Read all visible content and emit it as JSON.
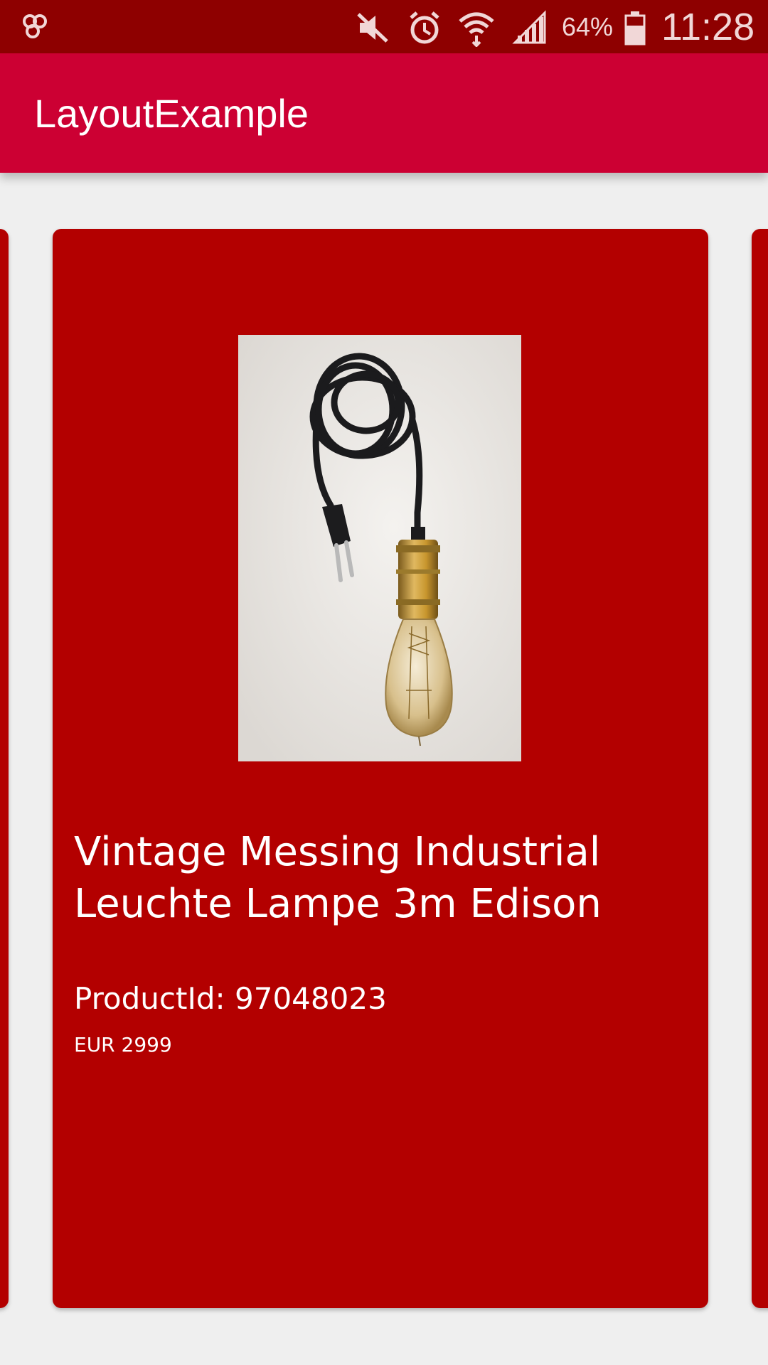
{
  "status_bar": {
    "battery": "64%",
    "time": "11:28",
    "icons": [
      "app-notification-icon",
      "mute-icon",
      "alarm-icon",
      "wifi-icon",
      "signal-icon",
      "battery-icon"
    ]
  },
  "app_bar": {
    "title": "LayoutExample"
  },
  "product": {
    "title": "Vintage Messing Industrial Leuchte Lampe 3m Edison",
    "product_id": "ProductId: 97048023",
    "price": "EUR 2999",
    "image_alt": "Vintage brass pendant lamp with black cable, plug and Edison bulb"
  },
  "colors": {
    "status_bar": "#8e0000",
    "app_bar": "#cc0033",
    "card": "#b30000",
    "background": "#efefef"
  }
}
